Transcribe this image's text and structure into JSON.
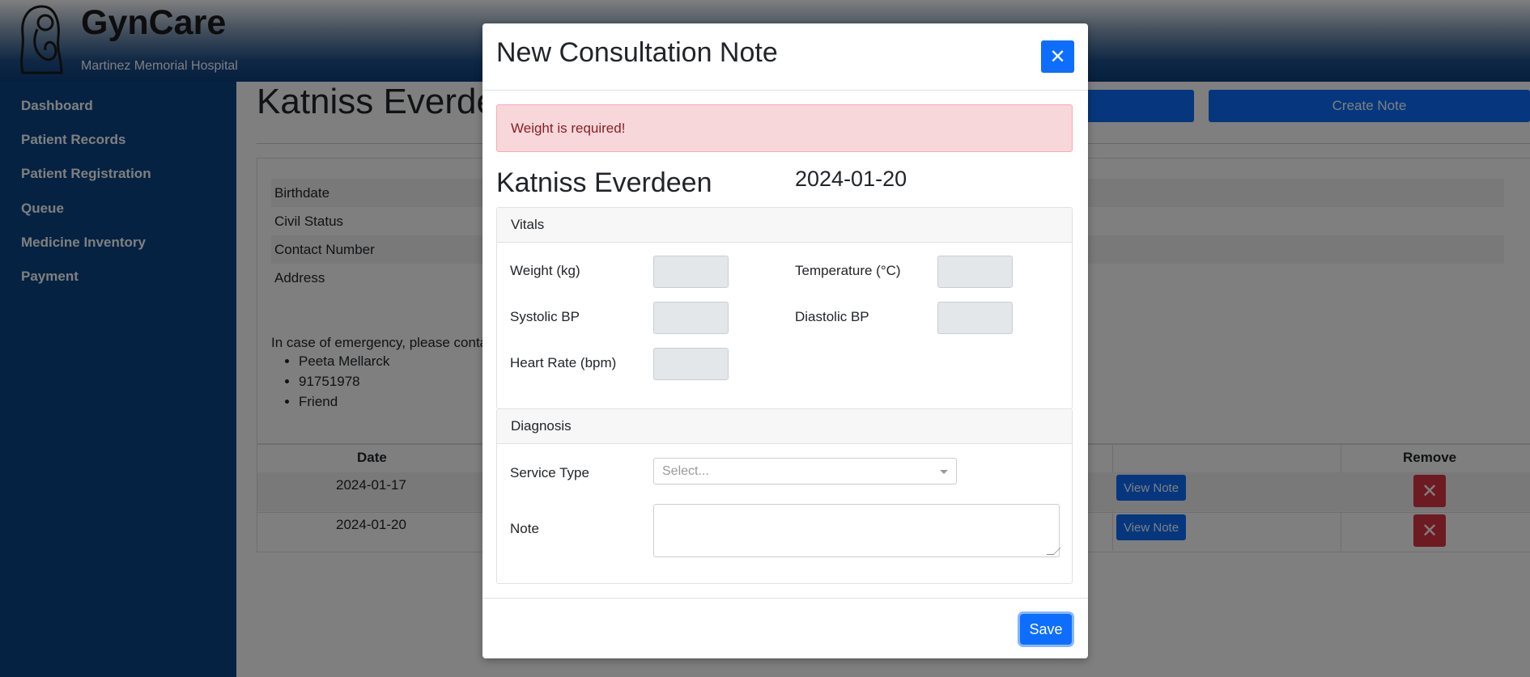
{
  "app": {
    "brand": "GynCare",
    "hospital": "Martinez Memorial Hospital"
  },
  "sidebar": {
    "items": [
      {
        "label": "Dashboard"
      },
      {
        "label": "Patient Records"
      },
      {
        "label": "Patient Registration"
      },
      {
        "label": "Queue"
      },
      {
        "label": "Medicine Inventory"
      },
      {
        "label": "Payment"
      }
    ]
  },
  "page": {
    "patient_name_partial": "Katniss Everde",
    "buttons": {
      "create_note": "Create Note"
    },
    "info_rows": [
      {
        "label": "Birthdate"
      },
      {
        "label": "Civil Status"
      },
      {
        "label": "Contact Number"
      },
      {
        "label": "Address"
      }
    ],
    "emergency_text": "In case of emergency, please conta",
    "emergency_contact": [
      "Peeta Mellarck",
      "91751978",
      "Friend"
    ],
    "notes_table": {
      "headers": {
        "date": "Date",
        "remove": "Remove"
      },
      "rows": [
        {
          "date": "2024-01-17",
          "view": "View Note"
        },
        {
          "date": "2024-01-20",
          "view": "View Note"
        }
      ]
    }
  },
  "modal": {
    "title": "New Consultation Note",
    "close_icon": "✕",
    "alert": "Weight is required!",
    "patient_name": "Katniss Everdeen",
    "date": "2024-01-20",
    "vitals": {
      "header": "Vitals",
      "weight_label": "Weight (kg)",
      "temperature_label": "Temperature (°C)",
      "systolic_label": "Systolic BP",
      "diastolic_label": "Diastolic BP",
      "heart_rate_label": "Heart Rate (bpm)"
    },
    "diagnosis": {
      "header": "Diagnosis",
      "service_type_label": "Service Type",
      "service_type_placeholder": "Select...",
      "note_label": "Note"
    },
    "save_label": "Save"
  }
}
